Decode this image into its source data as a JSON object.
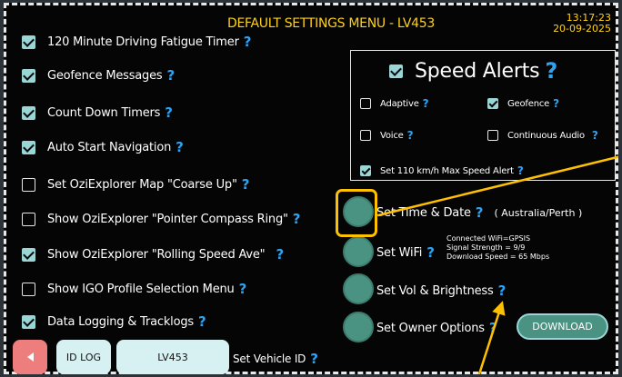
{
  "header": {
    "title": "DEFAULT SETTINGS MENU - LV453",
    "time": "13:17:23",
    "date": "20-09-2025"
  },
  "options": [
    {
      "label": "120 Minute Driving Fatigue Timer",
      "checked": true,
      "help": "?"
    },
    {
      "label": "Geofence Messages",
      "checked": true,
      "help": "?"
    },
    {
      "label": "Count Down Timers",
      "checked": true,
      "help": "?"
    },
    {
      "label": "Auto Start Navigation",
      "checked": true,
      "help": "?"
    },
    {
      "label": "Set OziExplorer Map \"Coarse Up\"",
      "checked": false,
      "help": "?"
    },
    {
      "label": "Show OziExplorer \"Pointer Compass Ring\"",
      "checked": false,
      "help": "?"
    },
    {
      "label": "Show OziExplorer \"Rolling Speed Ave\"",
      "checked": true,
      "help": "?"
    },
    {
      "label": "Show IGO Profile Selection Menu",
      "checked": false,
      "help": "?"
    },
    {
      "label": "Data Logging & Tracklogs",
      "checked": true,
      "help": "?"
    }
  ],
  "speed_alerts": {
    "title": "Speed Alerts",
    "checked": true,
    "help": "?",
    "items": [
      {
        "label": "Adaptive",
        "checked": false,
        "help": "?"
      },
      {
        "label": "Geofence",
        "checked": true,
        "help": "?"
      },
      {
        "label": "Voice",
        "checked": false,
        "help": "?"
      },
      {
        "label": "Continuous Audio",
        "checked": false,
        "help": "?"
      },
      {
        "label": "Set 110 km/h Max Speed Alert",
        "checked": true,
        "help": "?"
      }
    ]
  },
  "actions": {
    "time_date": {
      "label": "Set Time & Date",
      "help": "?",
      "timezone": "( Australia/Perth )"
    },
    "wifi": {
      "label": "Set WiFi",
      "help": "?",
      "info": [
        "Connected WiFi=GPSIS",
        "Signal Strength = 9/9",
        "Download Speed = 65 Mbps"
      ]
    },
    "vol": {
      "label": "Set Vol & Brightness",
      "help": "?"
    },
    "owner": {
      "label": "Set Owner Options",
      "help": "?"
    },
    "download": "DOWNLOAD"
  },
  "bottom": {
    "idlog": "ID LOG",
    "vehicle": "LV453",
    "set_vehicle_label": "Set Vehicle ID",
    "help": "?"
  },
  "colors": {
    "accent_yellow": "#ffd21a",
    "help_blue": "#2ea3f2",
    "button_teal": "#4a9282",
    "back_red": "#ee7e7e",
    "highlight": "#ffc000"
  }
}
